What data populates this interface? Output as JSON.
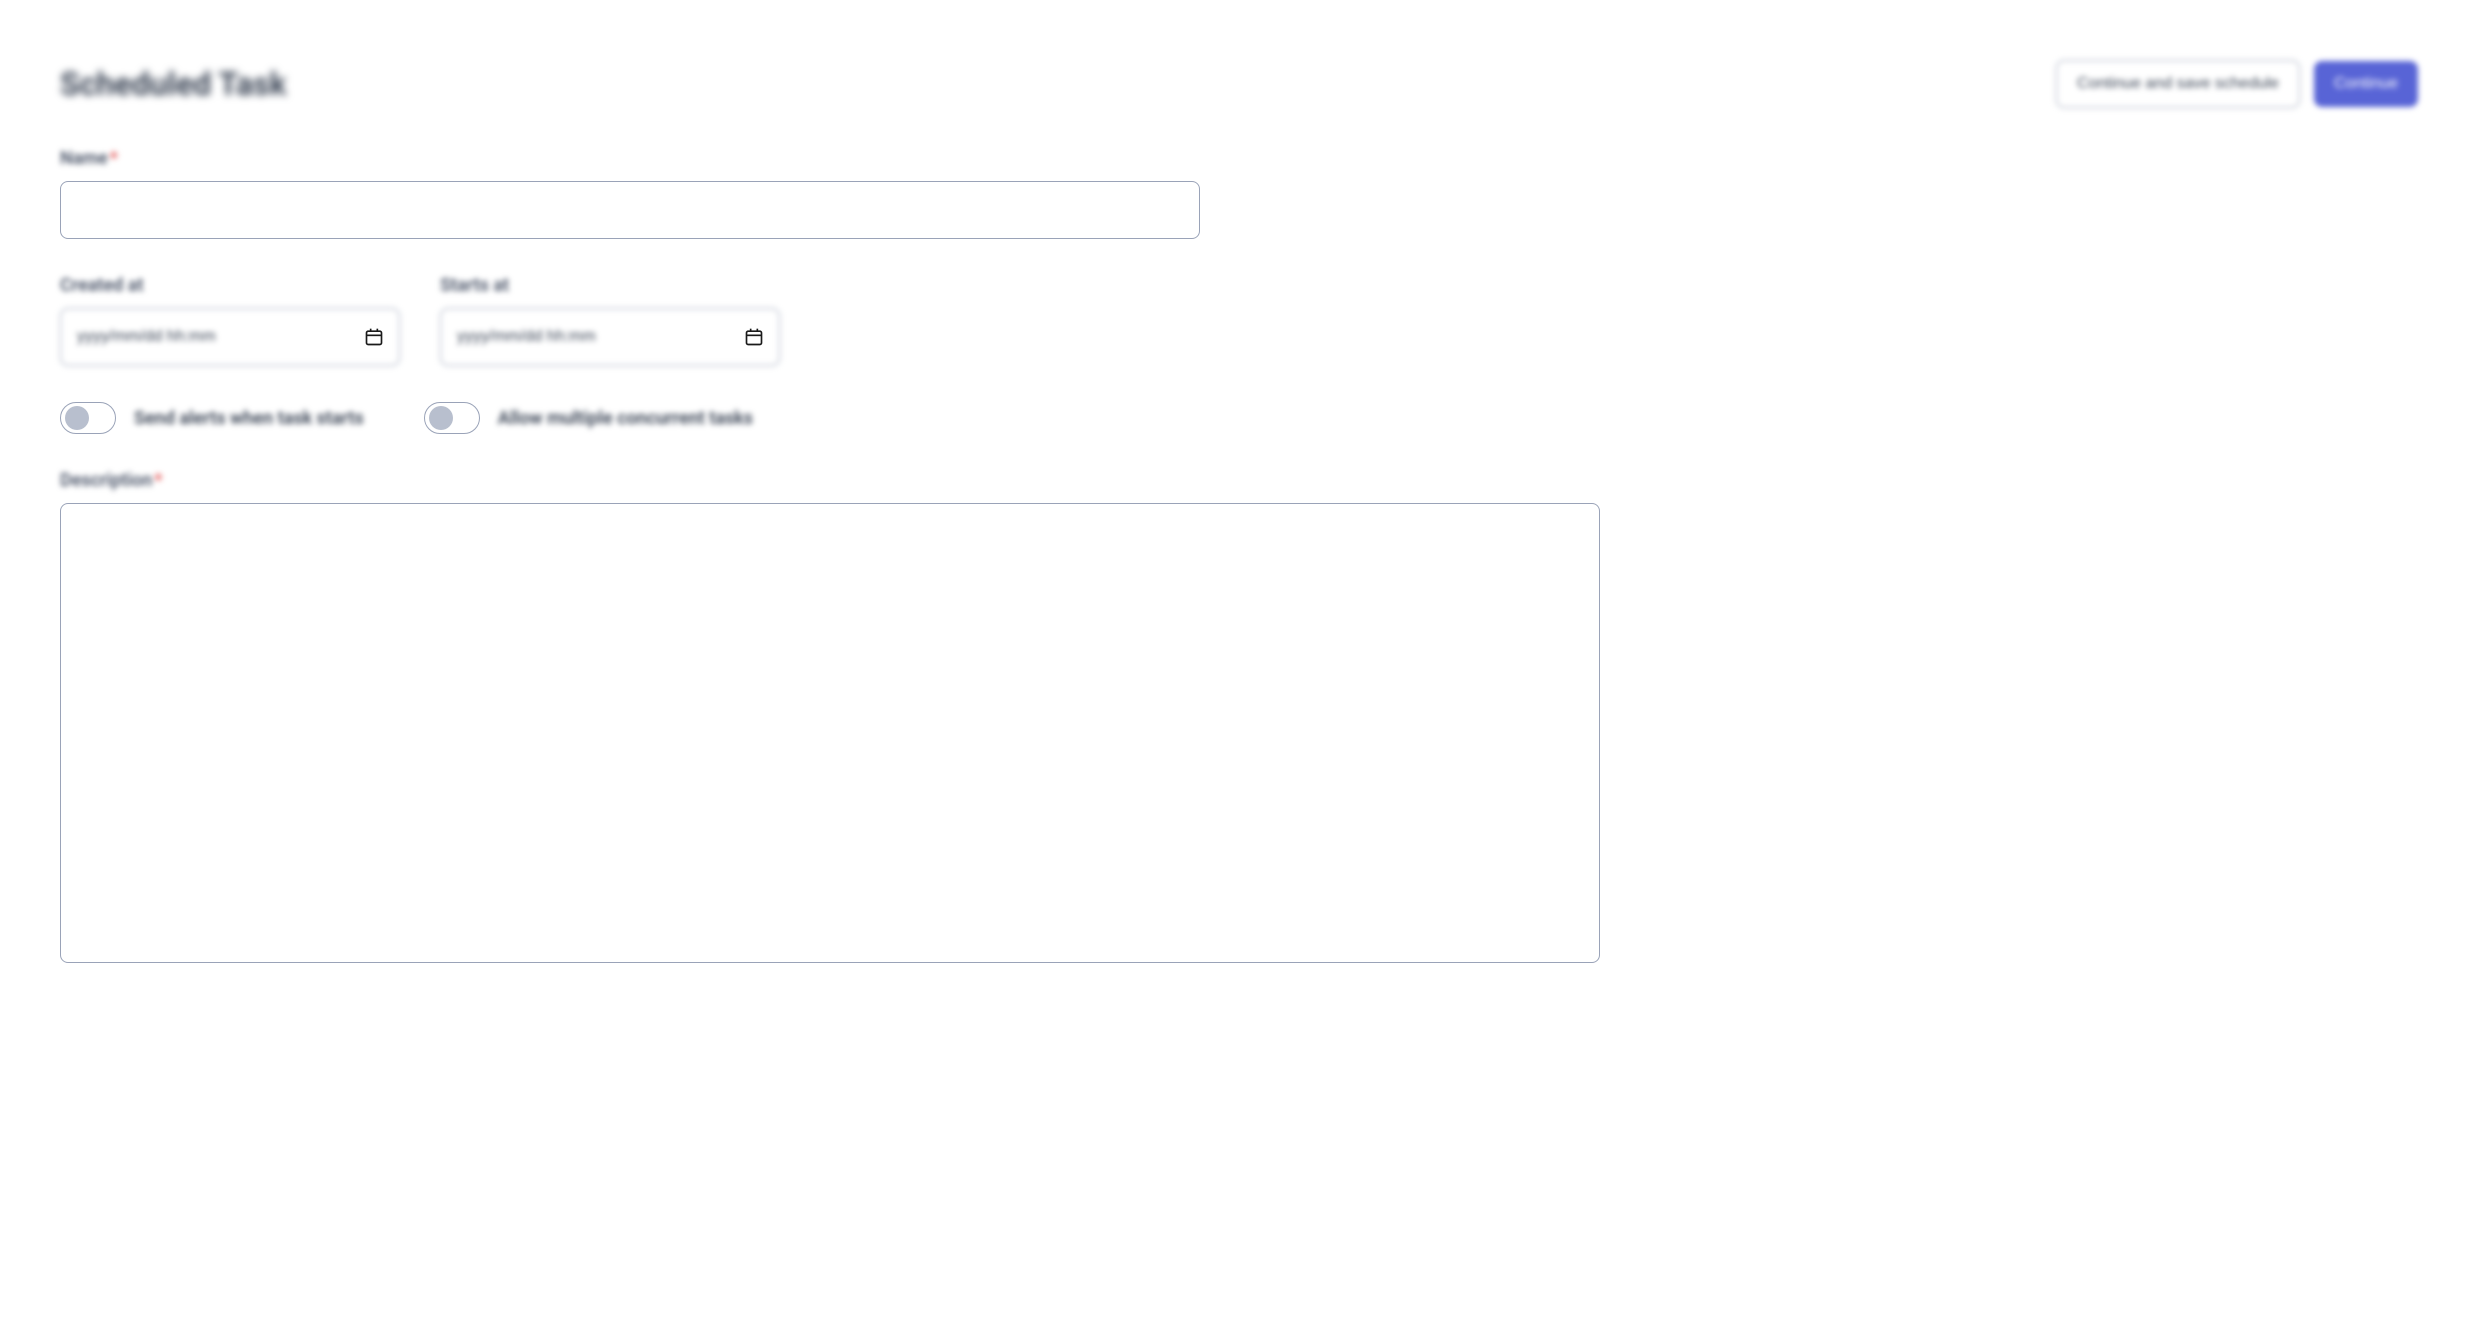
{
  "page": {
    "title": "Scheduled Task"
  },
  "header": {
    "secondary_button_label": "Continue and save schedule",
    "primary_button_label": "Continue"
  },
  "form": {
    "name": {
      "label": "Name",
      "required": true,
      "value": ""
    },
    "dates": {
      "created_label": "Created at",
      "created_value": "yyyy/mm/dd hh:mm",
      "starts_label": "Starts at",
      "starts_value": "yyyy/mm/dd hh:mm"
    },
    "toggles": {
      "toggle_1_label": "Send alerts when task starts",
      "toggle_1_on": false,
      "toggle_2_label": "Allow multiple concurrent tasks",
      "toggle_2_on": false
    },
    "description": {
      "label": "Description",
      "required": true,
      "value": ""
    }
  }
}
